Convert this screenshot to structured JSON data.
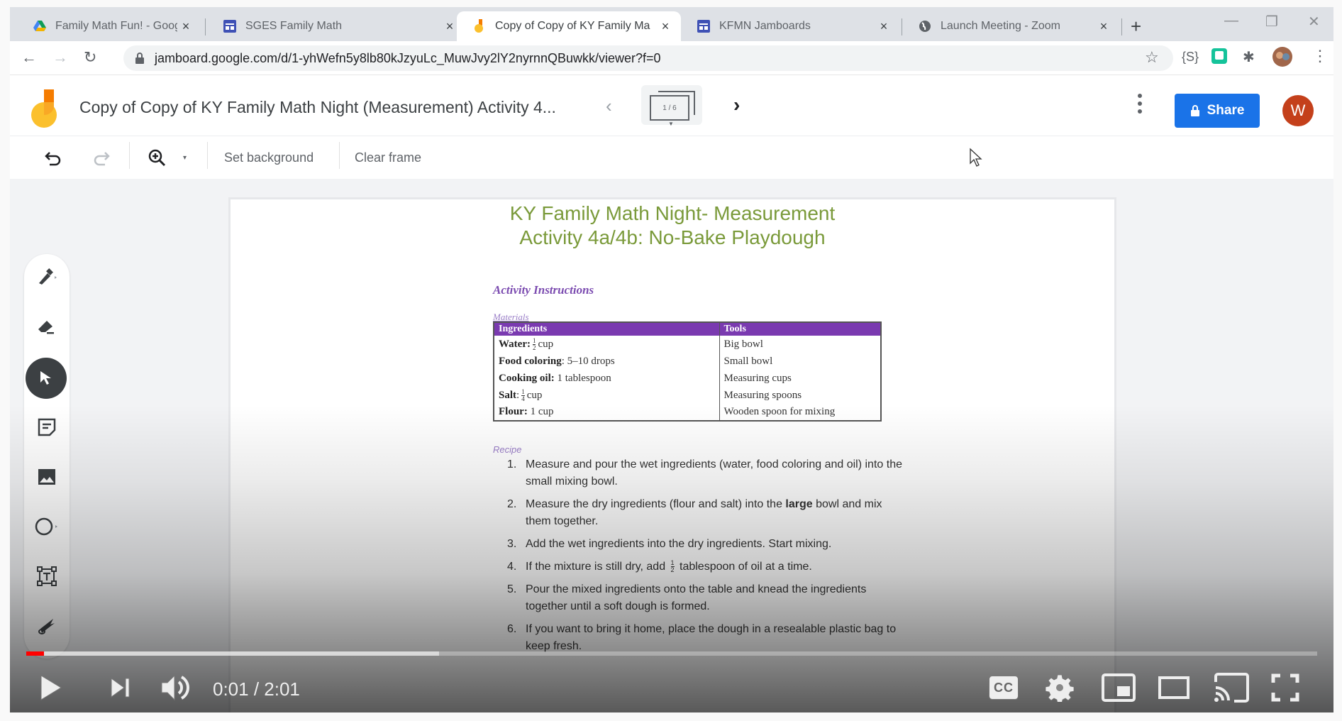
{
  "browser": {
    "tabs": [
      {
        "label": "Family Math Fun! - Google Dr",
        "icon": "google-drive-icon",
        "active": false
      },
      {
        "label": "SGES Family Math",
        "icon": "google-sites-icon",
        "active": false
      },
      {
        "label": "Copy of Copy of KY Family Ma",
        "icon": "jamboard-icon",
        "active": true
      },
      {
        "label": "KFMN Jamboards",
        "icon": "google-sites-icon",
        "active": false
      },
      {
        "label": "Launch Meeting - Zoom",
        "icon": "globe-icon",
        "active": false
      }
    ],
    "close_glyph": "×",
    "new_tab_glyph": "+",
    "url": "jamboard.google.com/d/1-yhWefn5y8lb80kJzyuLc_MuwJvy2lY2nyrnnQBuwkk/viewer?f=0",
    "extensions": [
      "{S}",
      "grammarly-icon",
      "puzzle-icon"
    ]
  },
  "jamboard": {
    "title": "Copy of Copy of KY Family Math Night (Measurement) Activity 4...",
    "frame_counter": "1 / 6",
    "share_label": "Share",
    "avatar_letter": "W",
    "toolbar": {
      "set_background": "Set background",
      "clear_frame": "Clear frame"
    },
    "tools": [
      {
        "name": "pen-tool",
        "selected": false
      },
      {
        "name": "eraser-tool",
        "selected": false
      },
      {
        "name": "select-tool",
        "selected": true
      },
      {
        "name": "sticky-note-tool",
        "selected": false
      },
      {
        "name": "add-image-tool",
        "selected": false
      },
      {
        "name": "circle-tool",
        "selected": false
      },
      {
        "name": "text-box-tool",
        "selected": false
      },
      {
        "name": "laser-tool",
        "selected": false
      }
    ],
    "colors": {
      "accent": "#1a73e8",
      "avatar": "#c4401b",
      "title_green": "#7a9a3a",
      "purple": "#7a3ab0"
    }
  },
  "document": {
    "title_line1": "KY Family Math Night- Measurement",
    "title_line2": "Activity 4a/4b: No-Bake Playdough",
    "section": "Activity Instructions",
    "materials_label": "Materials",
    "table": {
      "headers": [
        "Ingredients",
        "Tools"
      ],
      "rows": [
        {
          "ing_name": "Water:",
          "ing_frac": [
            "1",
            "2"
          ],
          "ing_rest": "cup",
          "tool": "Big bowl"
        },
        {
          "ing_name": "Food coloring",
          "ing_frac": null,
          "ing_rest": ": 5–10 drops",
          "tool": "Small bowl"
        },
        {
          "ing_name": "Cooking oil:",
          "ing_frac": null,
          "ing_rest": "1 tablespoon",
          "tool": "Measuring cups"
        },
        {
          "ing_name": "Salt",
          "ing_frac": [
            "1",
            "4"
          ],
          "ing_rest": "cup",
          "tool": "Measuring spoons",
          "ing_colon": ":"
        },
        {
          "ing_name": "Flour:",
          "ing_frac": null,
          "ing_rest": "1 cup",
          "tool": "Wooden spoon for mixing"
        }
      ]
    },
    "recipe_label": "Recipe",
    "recipe_steps": [
      {
        "num": "1.",
        "text": "Measure and pour the wet ingredients (water, food coloring and oil) into the small mixing bowl."
      },
      {
        "num": "2.",
        "pre": "Measure the dry ingredients (flour and salt) into the ",
        "bold": "large",
        "post": " bowl and mix them together."
      },
      {
        "num": "3.",
        "text": "Add the wet ingredients into the dry ingredients. Start mixing."
      },
      {
        "num": "4.",
        "pre": "If the mixture is still dry, add ",
        "frac": [
          "1",
          "2"
        ],
        "post": " tablespoon of oil at a time."
      },
      {
        "num": "5.",
        "text": "Pour the mixed ingredients onto the table and knead the ingredients together until a soft dough is formed."
      },
      {
        "num": "6.",
        "text": "If you want to bring it home, place the dough in a resealable plastic bag to keep fresh."
      }
    ]
  },
  "video_player": {
    "time_display": "0:01 / 2:01",
    "current_seconds": 1,
    "duration_seconds": 121,
    "buffered_fraction": 0.32,
    "controls": [
      "play",
      "next",
      "volume",
      "captions",
      "settings",
      "miniplayer",
      "theater",
      "cast",
      "fullscreen"
    ],
    "cc_label": "CC",
    "progress_color": "#ff0000"
  }
}
